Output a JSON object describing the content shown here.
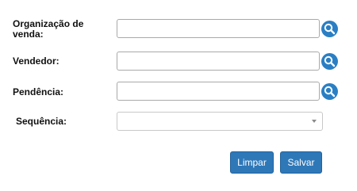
{
  "form": {
    "sales_org": {
      "label_line1": "Organização de",
      "label_line2": "venda:",
      "value": "",
      "search_icon": "search-icon"
    },
    "seller": {
      "label": "Vendedor:",
      "value": "",
      "search_icon": "search-icon"
    },
    "pending": {
      "label": "Pendência:",
      "value": "",
      "search_icon": "search-icon"
    },
    "sequence": {
      "label": "Sequência:",
      "selected": "",
      "arrow_icon": "chevron-down-icon"
    }
  },
  "actions": {
    "clear_label": "Limpar",
    "save_label": "Salvar"
  },
  "colors": {
    "button_blue": "#2e78b8",
    "icon_blue": "#2a7fc4",
    "input_border": "#a9a9a9"
  }
}
